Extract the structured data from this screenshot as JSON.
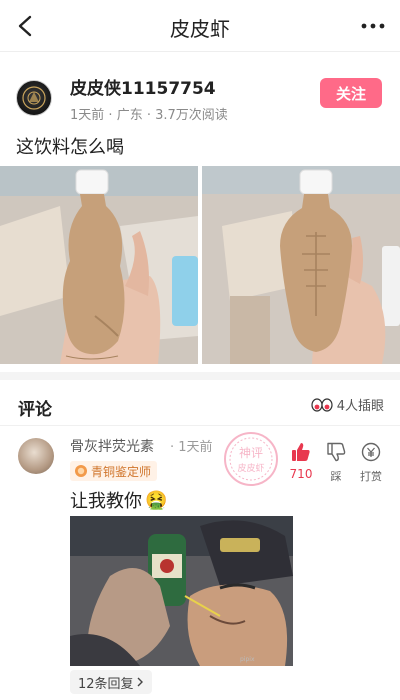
{
  "header": {
    "title": "皮皮虾",
    "back_icon": "chevron-left-icon",
    "more_icon": "more-dots-icon"
  },
  "post": {
    "username": "皮皮侠11157754",
    "time": "1天前",
    "location": "广东",
    "views": "3.7万次阅读",
    "follow_label": "关注",
    "text": "这饮料怎么喝",
    "colors": {
      "follow": "#ff6a88"
    }
  },
  "comments_section": {
    "title": "评论",
    "watchers": "4人插眼",
    "watch_icon": "eyes-icon"
  },
  "comment": {
    "username": "骨灰拌荧光素",
    "time": "1天前",
    "badge": "青铜鉴定师",
    "like_count": "710",
    "dislike_label": "踩",
    "tip_label": "打赏",
    "text": "让我教你",
    "emoji": "🤮",
    "replies_label": "12条回复",
    "stamp_text_1": "神评",
    "stamp_text_2": "皮皮虾"
  }
}
